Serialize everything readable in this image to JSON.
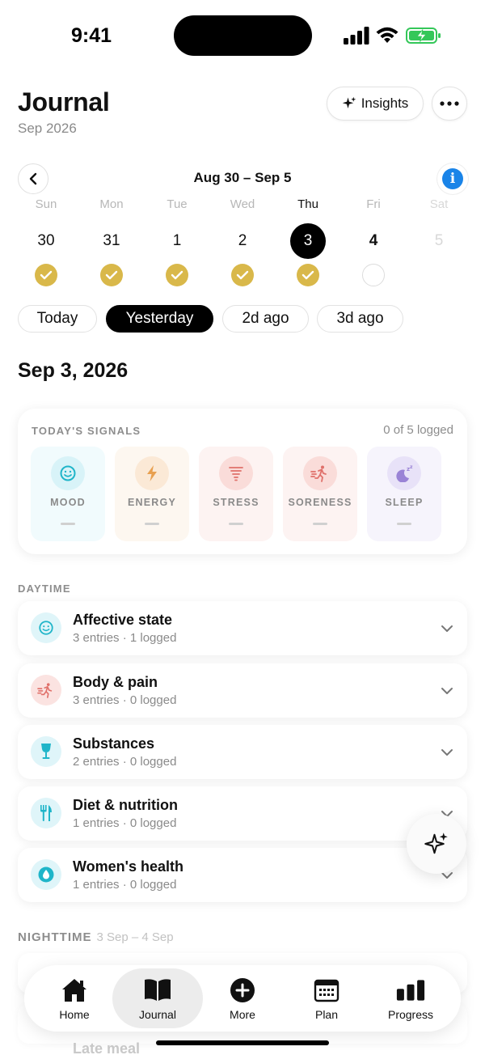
{
  "status": {
    "time": "9:41"
  },
  "header": {
    "title": "Journal",
    "subtitle": "Sep 2026",
    "insights_label": "Insights"
  },
  "week": {
    "range": "Aug 30 – Sep 5",
    "days": [
      {
        "name": "Sun",
        "num": "30",
        "state": "done"
      },
      {
        "name": "Mon",
        "num": "31",
        "state": "done"
      },
      {
        "name": "Tue",
        "num": "1",
        "state": "done"
      },
      {
        "name": "Wed",
        "num": "2",
        "state": "done"
      },
      {
        "name": "Thu",
        "num": "3",
        "state": "selected"
      },
      {
        "name": "Fri",
        "num": "4",
        "state": "empty"
      },
      {
        "name": "Sat",
        "num": "5",
        "state": "future"
      }
    ]
  },
  "quick": [
    "Today",
    "Yesterday",
    "2d ago",
    "3d ago"
  ],
  "date_heading": "Sep 3, 2026",
  "signals": {
    "label": "TODAY'S SIGNALS",
    "count": "0 of 5 logged",
    "items": [
      {
        "name": "MOOD",
        "value": "—"
      },
      {
        "name": "ENERGY",
        "value": "—"
      },
      {
        "name": "STRESS",
        "value": "—"
      },
      {
        "name": "SORENESS",
        "value": "—"
      },
      {
        "name": "SLEEP",
        "value": "—"
      }
    ]
  },
  "daytime": {
    "label": "DAYTIME",
    "categories": [
      {
        "title": "Affective state",
        "sub": "3 entries · 1 logged"
      },
      {
        "title": "Body & pain",
        "sub": "3 entries · 0 logged"
      },
      {
        "title": "Substances",
        "sub": "2 entries · 0 logged"
      },
      {
        "title": "Diet & nutrition",
        "sub": "1 entries · 0 logged"
      },
      {
        "title": "Women's health",
        "sub": "1 entries · 0 logged"
      }
    ]
  },
  "nighttime": {
    "label": "NIGHTTIME",
    "range": "3 Sep – 4 Sep",
    "late_meal": "Late meal"
  },
  "tabs": [
    "Home",
    "Journal",
    "More",
    "Plan",
    "Progress"
  ],
  "colors": {
    "check_gold": "#d9b84a",
    "info_blue": "#1a84e8",
    "accent_black": "#000000"
  }
}
